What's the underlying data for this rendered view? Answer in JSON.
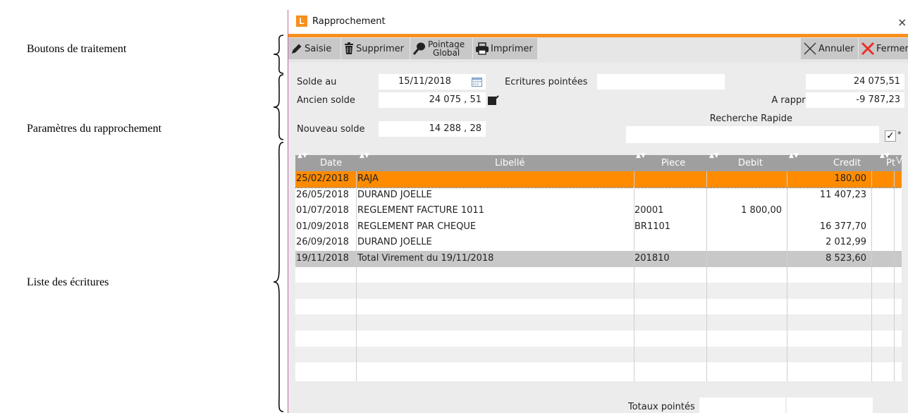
{
  "annotations": {
    "buttons": "Boutons de traitement",
    "params": "Paramètres du rapprochement",
    "list": "Liste des écritures"
  },
  "window": {
    "app_icon_letter": "L",
    "title": "Rapprochement",
    "close_glyph": "×"
  },
  "toolbar": {
    "saisie": "Saisie",
    "supprimer": "Supprimer",
    "pointage_line1": "Pointage",
    "pointage_line2": "Global",
    "imprimer": "Imprimer",
    "annuler": "Annuler",
    "fermer": "Fermer"
  },
  "params": {
    "solde_au_label": "Solde au",
    "solde_au_value": "15/11/2018",
    "ecritures_pointees_label": "Ecritures pointées",
    "ecritures_pointees_value": "",
    "solde_label": "Solde",
    "solde_value": "24 075,51",
    "ancien_solde_label": "Ancien solde",
    "ancien_solde_value": "24 075 , 51",
    "a_rapprocher_label": "A rapprocher",
    "a_rapprocher_value": "-9 787,23",
    "nouveau_solde_label": "Nouveau solde",
    "nouveau_solde_value": "14 288 , 28",
    "recherche_label": "Recherche Rapide",
    "recherche_value": "",
    "check_glyph": "✓",
    "star": "*"
  },
  "grid": {
    "columns": [
      "Date",
      "Libellé",
      "Piece",
      "Debit",
      "Credit",
      "Pt"
    ],
    "rows": [
      {
        "date": "25/02/2018",
        "libelle": "RAJA",
        "piece": "",
        "debit": "",
        "credit": "180,00"
      },
      {
        "date": "26/05/2018",
        "libelle": "DURAND JOELLE",
        "piece": "",
        "debit": "",
        "credit": "11 407,23"
      },
      {
        "date": "01/07/2018",
        "libelle": "REGLEMENT FACTURE 1011",
        "piece": "20001",
        "debit": "1 800,00",
        "credit": ""
      },
      {
        "date": "01/09/2018",
        "libelle": "REGLEMENT PAR CHEQUE",
        "piece": "BR1101",
        "debit": "",
        "credit": "16 377,70"
      },
      {
        "date": "26/09/2018",
        "libelle": "DURAND JOELLE",
        "piece": "",
        "debit": "",
        "credit": "2 012,99"
      },
      {
        "date": "19/11/2018",
        "libelle": "Total Virement du 19/11/2018",
        "piece": "201810",
        "debit": "",
        "credit": "8 523,60"
      }
    ]
  },
  "totals": {
    "label": "Totaux pointés"
  },
  "colors": {
    "accent_orange": "#f7901e",
    "selected_row": "#ff8c00",
    "highlight_row": "#c8c8c8",
    "header_gray": "#9f9f9f",
    "fermer_red": "#e8302a"
  }
}
